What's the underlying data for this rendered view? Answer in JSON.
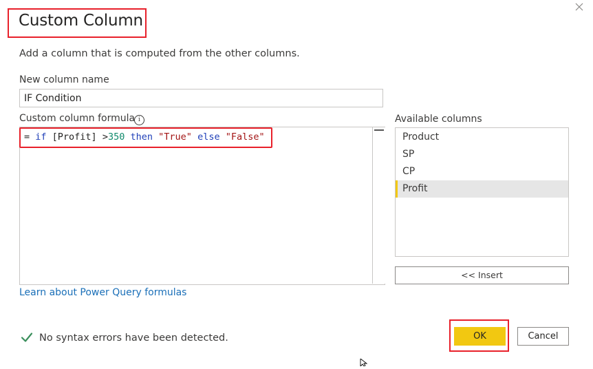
{
  "dialog": {
    "title": "Custom Column",
    "subtitle": "Add a column that is computed from the other columns.",
    "close_icon": "close-icon"
  },
  "name_field": {
    "label": "New column name",
    "value": "IF Condition"
  },
  "formula": {
    "label": "Custom column formula",
    "info_icon": "info-icon",
    "tokens": {
      "eq": "= ",
      "if": "if",
      "ref": " [Profit] ",
      "op": ">",
      "num": "350",
      "then": "then",
      "true_str": "\"True\"",
      "else": "else",
      "false_str": "\"False\""
    }
  },
  "learn_link": "Learn about Power Query formulas",
  "available_columns": {
    "label": "Available columns",
    "items": [
      "Product",
      "SP",
      "CP",
      "Profit"
    ],
    "selected": "Profit",
    "insert_label": "<< Insert"
  },
  "status": {
    "icon": "check-icon",
    "text": "No syntax errors have been detected."
  },
  "buttons": {
    "ok": "OK",
    "cancel": "Cancel"
  },
  "colors": {
    "accent_yellow": "#f2c811",
    "annotation_red": "#e8202a",
    "link_blue": "#1a6fb8",
    "check_green": "#3a8f5c"
  }
}
